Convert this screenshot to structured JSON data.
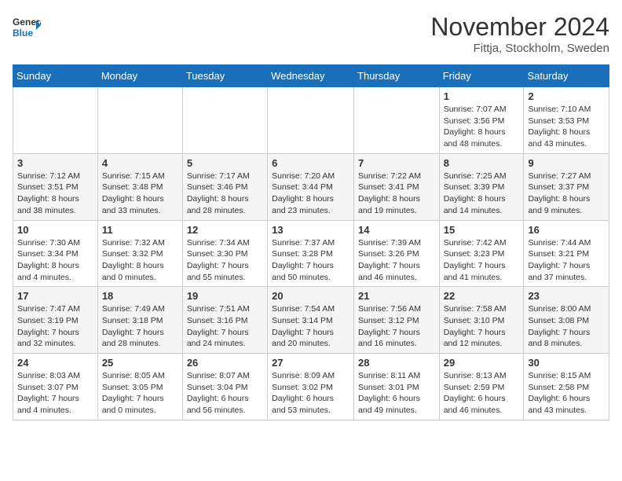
{
  "header": {
    "logo_line1": "General",
    "logo_line2": "Blue",
    "month_title": "November 2024",
    "location": "Fittja, Stockholm, Sweden"
  },
  "days_of_week": [
    "Sunday",
    "Monday",
    "Tuesday",
    "Wednesday",
    "Thursday",
    "Friday",
    "Saturday"
  ],
  "weeks": [
    [
      {
        "day": "",
        "info": ""
      },
      {
        "day": "",
        "info": ""
      },
      {
        "day": "",
        "info": ""
      },
      {
        "day": "",
        "info": ""
      },
      {
        "day": "",
        "info": ""
      },
      {
        "day": "1",
        "info": "Sunrise: 7:07 AM\nSunset: 3:56 PM\nDaylight: 8 hours and 48 minutes."
      },
      {
        "day": "2",
        "info": "Sunrise: 7:10 AM\nSunset: 3:53 PM\nDaylight: 8 hours and 43 minutes."
      }
    ],
    [
      {
        "day": "3",
        "info": "Sunrise: 7:12 AM\nSunset: 3:51 PM\nDaylight: 8 hours and 38 minutes."
      },
      {
        "day": "4",
        "info": "Sunrise: 7:15 AM\nSunset: 3:48 PM\nDaylight: 8 hours and 33 minutes."
      },
      {
        "day": "5",
        "info": "Sunrise: 7:17 AM\nSunset: 3:46 PM\nDaylight: 8 hours and 28 minutes."
      },
      {
        "day": "6",
        "info": "Sunrise: 7:20 AM\nSunset: 3:44 PM\nDaylight: 8 hours and 23 minutes."
      },
      {
        "day": "7",
        "info": "Sunrise: 7:22 AM\nSunset: 3:41 PM\nDaylight: 8 hours and 19 minutes."
      },
      {
        "day": "8",
        "info": "Sunrise: 7:25 AM\nSunset: 3:39 PM\nDaylight: 8 hours and 14 minutes."
      },
      {
        "day": "9",
        "info": "Sunrise: 7:27 AM\nSunset: 3:37 PM\nDaylight: 8 hours and 9 minutes."
      }
    ],
    [
      {
        "day": "10",
        "info": "Sunrise: 7:30 AM\nSunset: 3:34 PM\nDaylight: 8 hours and 4 minutes."
      },
      {
        "day": "11",
        "info": "Sunrise: 7:32 AM\nSunset: 3:32 PM\nDaylight: 8 hours and 0 minutes."
      },
      {
        "day": "12",
        "info": "Sunrise: 7:34 AM\nSunset: 3:30 PM\nDaylight: 7 hours and 55 minutes."
      },
      {
        "day": "13",
        "info": "Sunrise: 7:37 AM\nSunset: 3:28 PM\nDaylight: 7 hours and 50 minutes."
      },
      {
        "day": "14",
        "info": "Sunrise: 7:39 AM\nSunset: 3:26 PM\nDaylight: 7 hours and 46 minutes."
      },
      {
        "day": "15",
        "info": "Sunrise: 7:42 AM\nSunset: 3:23 PM\nDaylight: 7 hours and 41 minutes."
      },
      {
        "day": "16",
        "info": "Sunrise: 7:44 AM\nSunset: 3:21 PM\nDaylight: 7 hours and 37 minutes."
      }
    ],
    [
      {
        "day": "17",
        "info": "Sunrise: 7:47 AM\nSunset: 3:19 PM\nDaylight: 7 hours and 32 minutes."
      },
      {
        "day": "18",
        "info": "Sunrise: 7:49 AM\nSunset: 3:18 PM\nDaylight: 7 hours and 28 minutes."
      },
      {
        "day": "19",
        "info": "Sunrise: 7:51 AM\nSunset: 3:16 PM\nDaylight: 7 hours and 24 minutes."
      },
      {
        "day": "20",
        "info": "Sunrise: 7:54 AM\nSunset: 3:14 PM\nDaylight: 7 hours and 20 minutes."
      },
      {
        "day": "21",
        "info": "Sunrise: 7:56 AM\nSunset: 3:12 PM\nDaylight: 7 hours and 16 minutes."
      },
      {
        "day": "22",
        "info": "Sunrise: 7:58 AM\nSunset: 3:10 PM\nDaylight: 7 hours and 12 minutes."
      },
      {
        "day": "23",
        "info": "Sunrise: 8:00 AM\nSunset: 3:08 PM\nDaylight: 7 hours and 8 minutes."
      }
    ],
    [
      {
        "day": "24",
        "info": "Sunrise: 8:03 AM\nSunset: 3:07 PM\nDaylight: 7 hours and 4 minutes."
      },
      {
        "day": "25",
        "info": "Sunrise: 8:05 AM\nSunset: 3:05 PM\nDaylight: 7 hours and 0 minutes."
      },
      {
        "day": "26",
        "info": "Sunrise: 8:07 AM\nSunset: 3:04 PM\nDaylight: 6 hours and 56 minutes."
      },
      {
        "day": "27",
        "info": "Sunrise: 8:09 AM\nSunset: 3:02 PM\nDaylight: 6 hours and 53 minutes."
      },
      {
        "day": "28",
        "info": "Sunrise: 8:11 AM\nSunset: 3:01 PM\nDaylight: 6 hours and 49 minutes."
      },
      {
        "day": "29",
        "info": "Sunrise: 8:13 AM\nSunset: 2:59 PM\nDaylight: 6 hours and 46 minutes."
      },
      {
        "day": "30",
        "info": "Sunrise: 8:15 AM\nSunset: 2:58 PM\nDaylight: 6 hours and 43 minutes."
      }
    ]
  ]
}
